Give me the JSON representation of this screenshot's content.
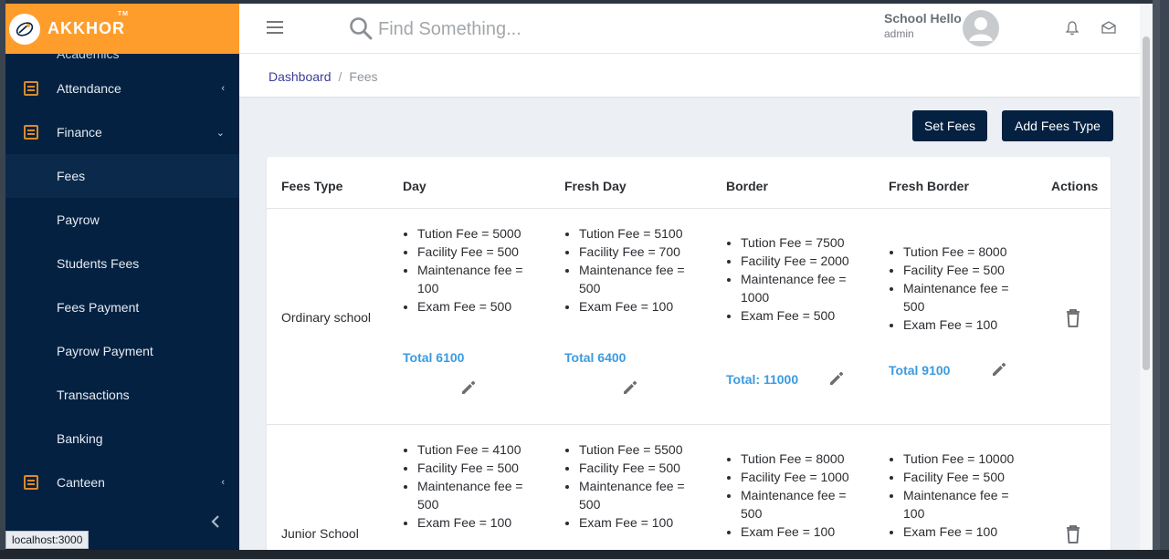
{
  "brand": {
    "name": "AKKHOR",
    "tm": "TM"
  },
  "sidebar": {
    "partial_item": "Academics",
    "items": [
      {
        "label": "Attendance",
        "chevron": "‹"
      },
      {
        "label": "Finance",
        "chevron": "⌄"
      }
    ],
    "sub_items": [
      "Fees",
      "Payrow",
      "Students Fees",
      "Fees Payment",
      "Payrow Payment",
      "Transactions",
      "Banking"
    ],
    "canteen": {
      "label": "Canteen",
      "chevron": "‹"
    },
    "collapse_icon": "chevron-left-icon"
  },
  "topbar": {
    "search_placeholder": "Find Something...",
    "user_name": "School Hello",
    "user_role": "admin"
  },
  "breadcrumb": {
    "home": "Dashboard",
    "separator": "/",
    "current": "Fees"
  },
  "actions": {
    "set_fees": "Set Fees",
    "add_fees_type": "Add Fees Type"
  },
  "table": {
    "headers": [
      "Fees Type",
      "Day",
      "Fresh Day",
      "Border",
      "Fresh Border",
      "Actions"
    ],
    "rows": [
      {
        "fees_type": "Ordinary school",
        "day": [
          "Tution Fee = 5000",
          "Facility Fee = 500",
          "Maintenance fee = 100",
          "Exam Fee = 500"
        ],
        "day_total": "Total 6100",
        "fresh_day": [
          "Tution Fee = 5100",
          "Facility Fee = 700",
          "Maintenance fee = 500",
          "Exam Fee = 100"
        ],
        "fresh_day_total": "Total 6400",
        "border": [
          "Tution Fee = 7500",
          "Facility Fee = 2000",
          "Maintenance fee = 1000",
          "Exam Fee = 500"
        ],
        "border_total": "Total: 11000",
        "fresh_border": [
          "Tution Fee = 8000",
          "Facility Fee = 500",
          "Maintenance fee = 500",
          "Exam Fee = 100"
        ],
        "fresh_border_total": "Total 9100"
      },
      {
        "fees_type": "Junior School",
        "day": [
          "Tution Fee = 4100",
          "Facility Fee = 500",
          "Maintenance fee = 500",
          "Exam Fee = 100"
        ],
        "fresh_day": [
          "Tution Fee = 5500",
          "Facility Fee = 500",
          "Maintenance fee = 500",
          "Exam Fee = 100"
        ],
        "border": [
          "Tution Fee = 8000",
          "Facility Fee = 1000",
          "Maintenance fee = 500",
          "Exam Fee = 100"
        ],
        "fresh_border": [
          "Tution Fee = 10000",
          "Facility Fee = 500",
          "Maintenance fee = 100",
          "Exam Fee = 100"
        ]
      }
    ]
  },
  "status_bar": {
    "url": "localhost:3000"
  },
  "colors": {
    "sidebar": "#042141",
    "brand": "#ff9d2c",
    "total": "#3b9be0",
    "button": "#042141"
  }
}
